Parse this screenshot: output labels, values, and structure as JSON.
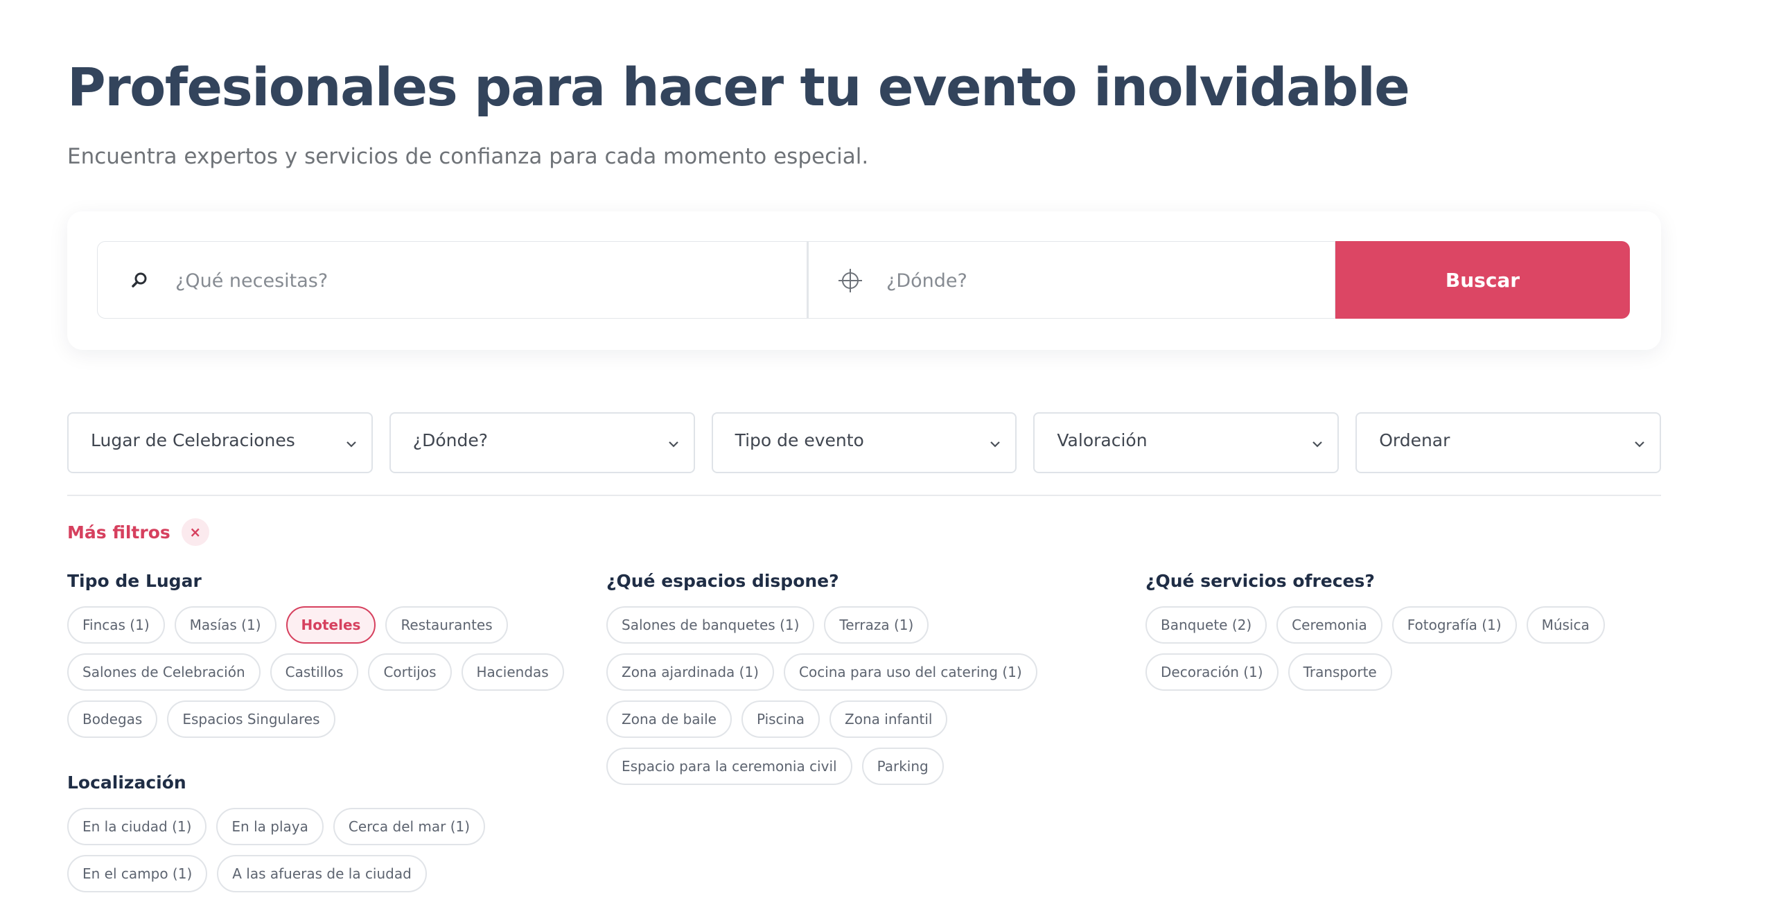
{
  "header": {
    "title": "Profesionales para hacer tu evento inolvidable",
    "subtitle": "Encuentra expertos y servicios de confianza para cada momento especial."
  },
  "search": {
    "what_placeholder": "¿Qué necesitas?",
    "where_placeholder": "¿Dónde?",
    "button_label": "Buscar",
    "icons": {
      "what": "search-icon",
      "where": "crosshair-icon"
    }
  },
  "filters": {
    "selects": [
      {
        "label": "Lugar de Celebraciones"
      },
      {
        "label": "¿Dónde?"
      },
      {
        "label": "Tipo de evento"
      },
      {
        "label": "Valoración"
      },
      {
        "label": "Ordenar"
      }
    ]
  },
  "more_filters": {
    "label": "Más filtros",
    "close_symbol": "×"
  },
  "groups": {
    "tipo_lugar": {
      "title": "Tipo de Lugar",
      "chips": [
        {
          "label": "Fincas (1)"
        },
        {
          "label": "Masías (1)"
        },
        {
          "label": "Hoteles",
          "active": true
        },
        {
          "label": "Restaurantes"
        },
        {
          "label": "Salones de Celebración"
        },
        {
          "label": "Castillos"
        },
        {
          "label": "Cortijos"
        },
        {
          "label": "Haciendas"
        },
        {
          "label": "Bodegas"
        },
        {
          "label": "Espacios Singulares"
        }
      ]
    },
    "espacios": {
      "title": "¿Qué espacios dispone?",
      "chips": [
        {
          "label": "Salones de banquetes (1)"
        },
        {
          "label": "Terraza (1)"
        },
        {
          "label": "Zona ajardinada (1)"
        },
        {
          "label": "Cocina para uso del catering (1)"
        },
        {
          "label": "Zona de baile"
        },
        {
          "label": "Piscina"
        },
        {
          "label": "Zona infantil"
        },
        {
          "label": "Espacio para la ceremonia civil"
        },
        {
          "label": "Parking"
        }
      ]
    },
    "servicios": {
      "title": "¿Qué servicios ofreces?",
      "chips": [
        {
          "label": "Banquete (2)"
        },
        {
          "label": "Ceremonia"
        },
        {
          "label": "Fotografía (1)"
        },
        {
          "label": "Música"
        },
        {
          "label": "Decoración (1)"
        },
        {
          "label": "Transporte"
        }
      ]
    },
    "localizacion": {
      "title": "Localización",
      "chips": [
        {
          "label": "En la ciudad (1)"
        },
        {
          "label": "En la playa"
        },
        {
          "label": "Cerca del mar (1)"
        },
        {
          "label": "En el campo (1)"
        },
        {
          "label": "A las afueras de la ciudad"
        }
      ]
    }
  },
  "colors": {
    "accent": "#dc4664",
    "title": "#33445c",
    "text_muted": "#6f7378",
    "border": "#e1e4e8"
  }
}
